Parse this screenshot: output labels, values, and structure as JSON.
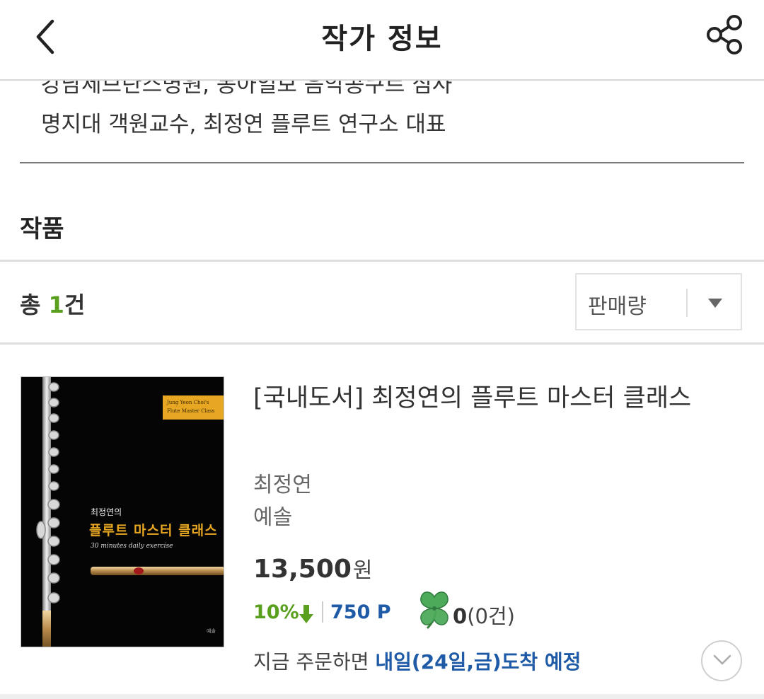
{
  "header": {
    "title": "작가 정보",
    "back_icon": "chevron-left-icon",
    "share_icon": "share-icon"
  },
  "author_info": {
    "clipped_line": "강남세브란스병원, 동아일보 음악콩쿠르 심사",
    "line": "명지대 객원교수, 최정연 플루트 연구소 대표"
  },
  "works": {
    "section_title": "작품",
    "count_prefix": "총 ",
    "count_value": "1",
    "count_suffix": "건",
    "sort": {
      "selected": "판매량",
      "icon": "caret-down-icon"
    }
  },
  "book": {
    "cover": {
      "band_line1": "Jung Yeon Choi's",
      "band_line2": "Flute Master Class",
      "small_title": "최정연의",
      "title": "플루트 마스터 클래스",
      "subtitle": "30 minutes daily exercise",
      "publisher_mark": "예솔"
    },
    "title": "[국내도서] 최정연의 플루트 마스터 클래스",
    "author": "최정연",
    "publisher": "예솔",
    "price": "13,500",
    "price_unit": "원",
    "discount": "10%",
    "points": "750 P",
    "clover_count": "0",
    "clover_reviews": "(0건)",
    "delivery_prefix": "지금 주문하면 ",
    "delivery_highlight": "내일(24일,금)도착 예정",
    "expand_icon": "chevron-down-circle-icon"
  },
  "colors": {
    "accent_green": "#5aa01e",
    "accent_blue": "#1f5aa6",
    "cover_gold": "#e8a722"
  }
}
